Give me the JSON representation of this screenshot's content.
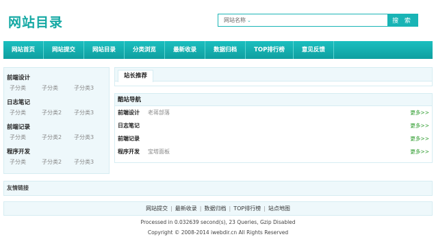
{
  "logo": "网站目录",
  "search": {
    "category": "网站名称",
    "placeholder": "",
    "button": "搜 索"
  },
  "nav": [
    "网站首页",
    "网站提交",
    "网站目录",
    "分类浏览",
    "最新收录",
    "数据归档",
    "TOP排行榜",
    "意见反馈"
  ],
  "sidebar": [
    {
      "title": "前端设计",
      "subs": [
        "子分类",
        "子分类",
        "子分类3"
      ]
    },
    {
      "title": "日志笔记",
      "subs": [
        "子分类",
        "子分类2",
        "子分类3"
      ]
    },
    {
      "title": "前端记录",
      "subs": [
        "子分类",
        "子分类2",
        "子分类3"
      ]
    },
    {
      "title": "程序开发",
      "subs": [
        "子分类",
        "子分类2",
        "子分类3"
      ]
    }
  ],
  "recommend": {
    "tab": "站长推荐"
  },
  "cool": {
    "title": "酷站导航",
    "rows": [
      {
        "name": "前端设计",
        "link": "老蒋部落",
        "more": "更多>>"
      },
      {
        "name": "日志笔记",
        "link": "",
        "more": "更多>>"
      },
      {
        "name": "前端记录",
        "link": "",
        "more": "更多>>"
      },
      {
        "name": "程序开发",
        "link": "宝塔面板",
        "more": "更多>>"
      }
    ]
  },
  "friend_links": {
    "title": "友情链接"
  },
  "footer": {
    "links": [
      "网站提交",
      "最新收录",
      "数据归档",
      "TOP排行榜",
      "站点地图"
    ],
    "processed": "Processed in 0.032639 second(s), 23 Queries, Gzip Disabled",
    "copyright": "Copyright © 2008-2014 iwebdir.cn All Rights Reserved"
  }
}
